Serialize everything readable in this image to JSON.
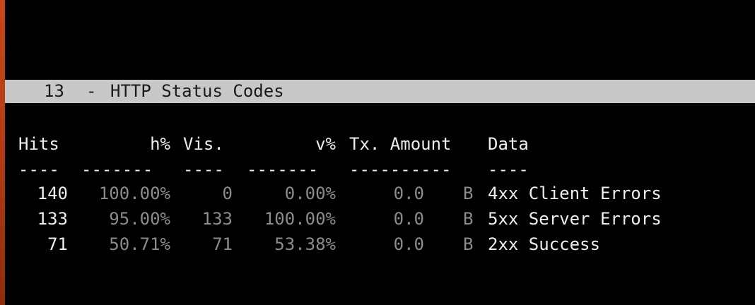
{
  "panel": {
    "number": "13",
    "separator": "-",
    "title": "HTTP Status Codes"
  },
  "table": {
    "headers": {
      "hits": "Hits",
      "h_pct": "h%",
      "vis": "Vis.",
      "v_pct": "v%",
      "tx_amount": "Tx. Amount",
      "data": "Data"
    },
    "dashes": {
      "hits": "----",
      "h_pct": "-------",
      "vis": "----",
      "v_pct": "-------",
      "tx_amount": "----------",
      "data": "----"
    },
    "rows": [
      {
        "hits": "140",
        "h_pct": "100.00%",
        "vis": "0",
        "v_pct": "0.00%",
        "tx": "0.0",
        "unit": "B",
        "data": "4xx Client Errors"
      },
      {
        "hits": "133",
        "h_pct": "95.00%",
        "vis": "133",
        "v_pct": "100.00%",
        "tx": "0.0",
        "unit": "B",
        "data": "5xx Server Errors"
      },
      {
        "hits": "71",
        "h_pct": "50.71%",
        "vis": "71",
        "v_pct": "53.38%",
        "tx": "0.0",
        "unit": "B",
        "data": "2xx Success"
      }
    ]
  },
  "colors": {
    "background": "#000000",
    "title_bar": "#c8c8c8",
    "text_bright": "#eeeeee",
    "text_dim": "#8c8c8c",
    "desktop_edge": "#c8461a"
  }
}
